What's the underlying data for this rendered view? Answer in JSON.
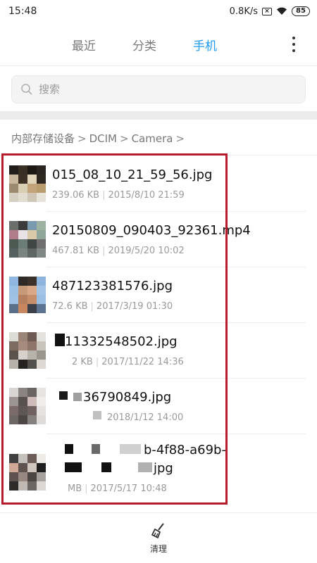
{
  "status": {
    "time": "15:48",
    "speed": "0.8K/s",
    "battery": "85"
  },
  "tabs": [
    {
      "label": "最近"
    },
    {
      "label": "分类"
    },
    {
      "label": "手机"
    }
  ],
  "search": {
    "placeholder": "搜索"
  },
  "breadcrumb": [
    "内部存储设备",
    "DCIM",
    "Camera"
  ],
  "files": [
    {
      "name": "015_08_10_21_59_56.jpg",
      "size": "239.06 KB",
      "date": "2015/8/10 21:59"
    },
    {
      "name": "20150809_090403_92361.mp4",
      "size": "467.81 KB",
      "date": "2019/5/20 10:02"
    },
    {
      "name": "487123381576.jpg",
      "size": "72.6 KB",
      "date": "2017/3/19 01:30"
    },
    {
      "name": "11332548502.jpg",
      "size": "2 KB",
      "date": "2017/11/22 14:36"
    },
    {
      "name": "36790849.jpg",
      "size": "",
      "date": "2018/1/12 14:00"
    },
    {
      "name": "b-4f88-a69b-",
      "name2": "jpg",
      "size": "MB",
      "date": "2017/5/17 10:48"
    }
  ],
  "bottom": {
    "label": "清理"
  },
  "colors": {
    "accent": "#1e9bf0",
    "annotation": "#b71c2c"
  }
}
